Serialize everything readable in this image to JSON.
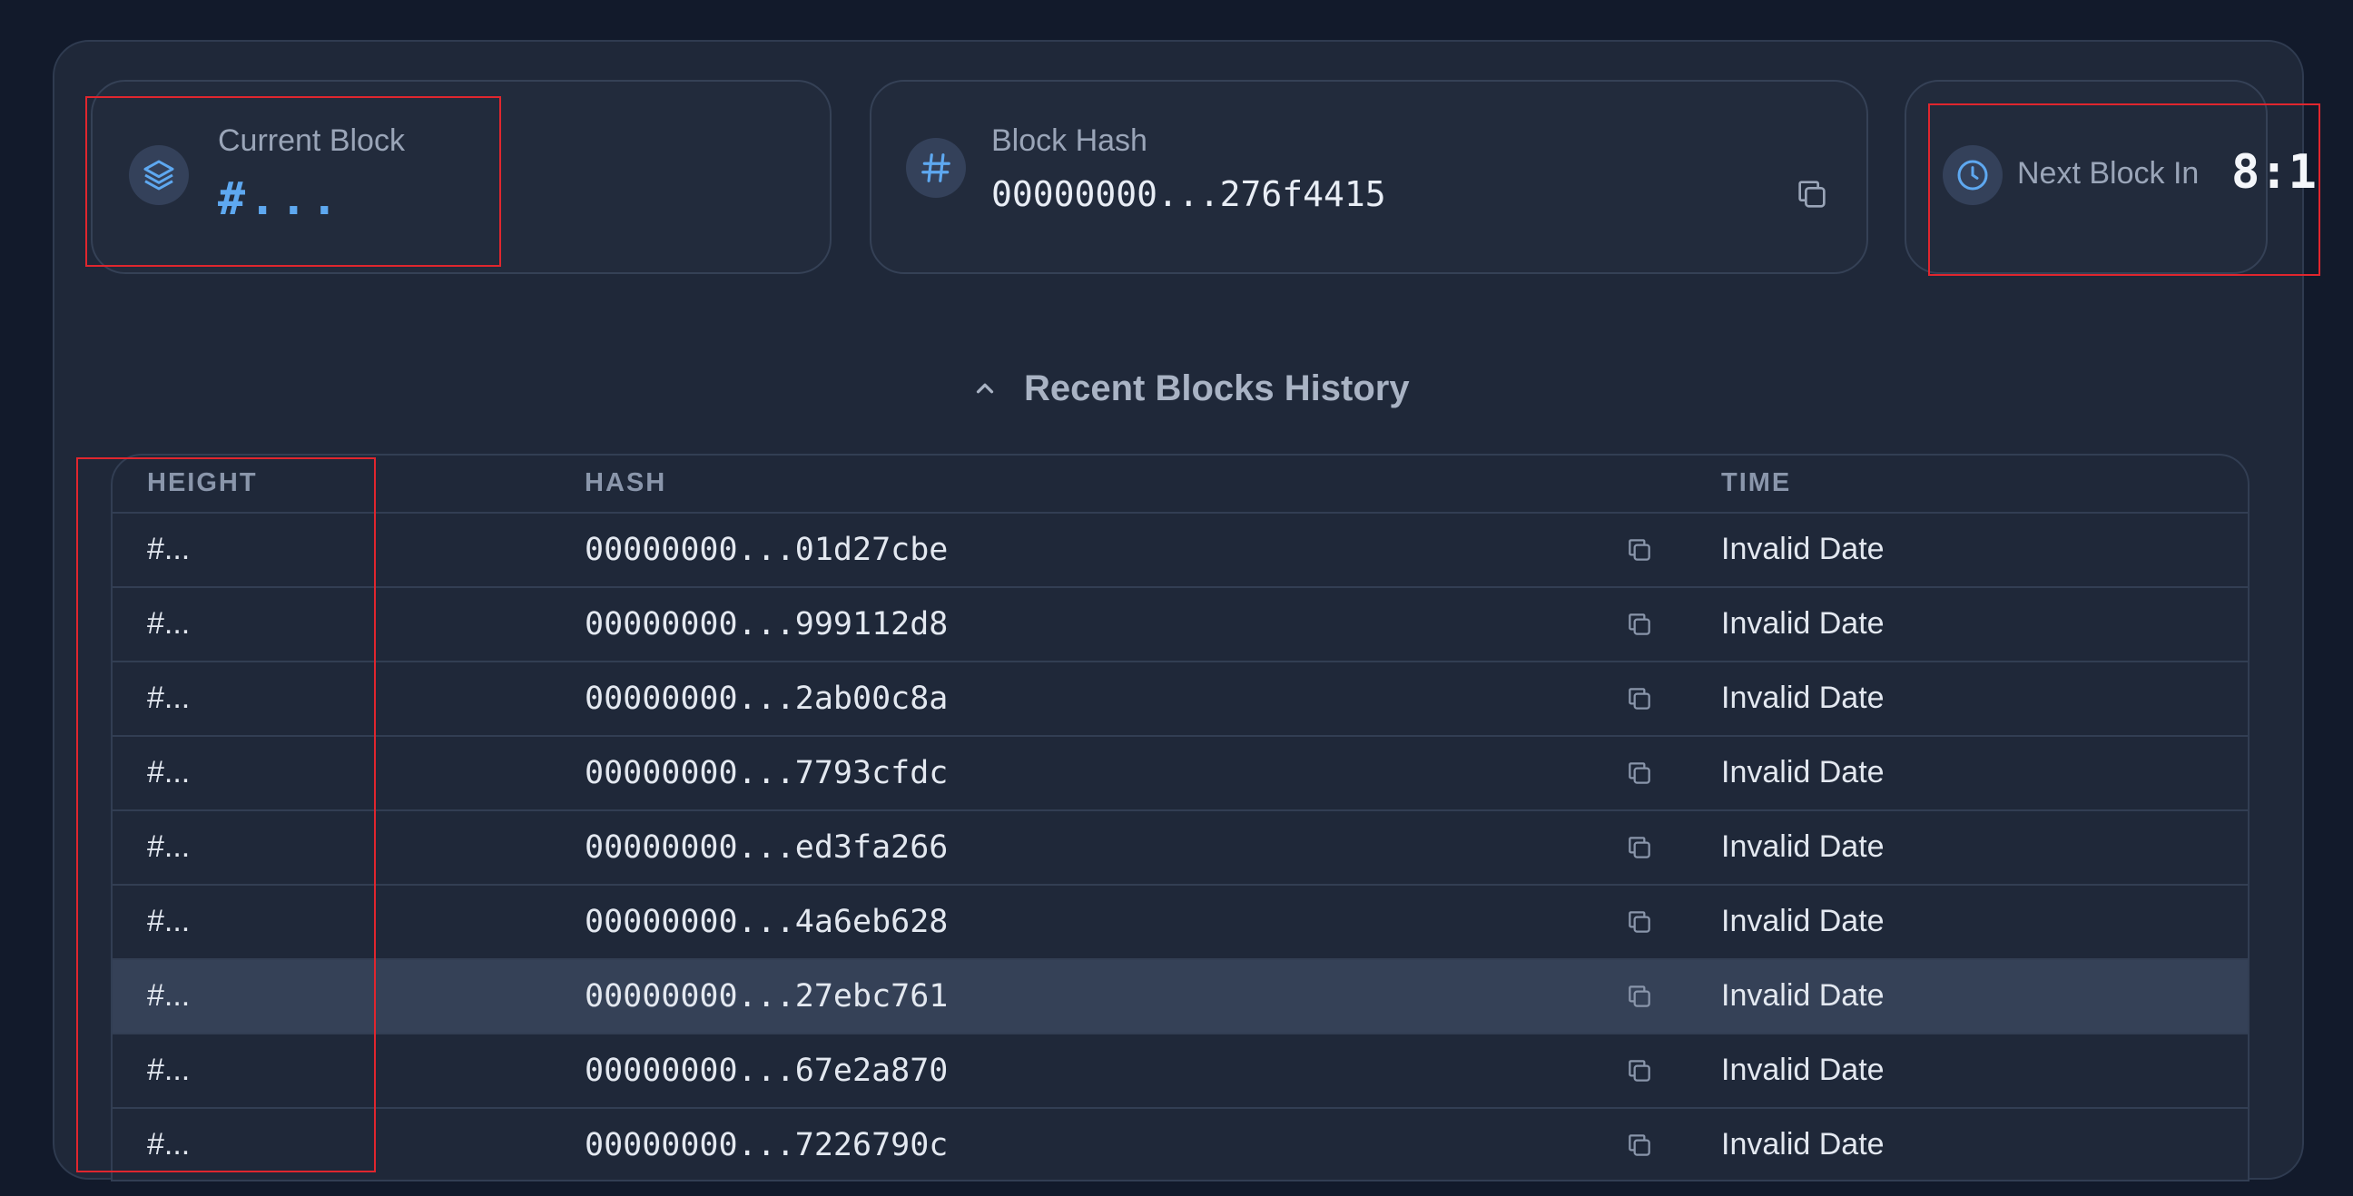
{
  "cards": {
    "current_block": {
      "label": "Current Block",
      "value": "#...",
      "icon": "layers-icon"
    },
    "block_hash": {
      "label": "Block Hash",
      "value": "00000000...276f4415",
      "icon": "hash-icon",
      "copy_icon": "copy-icon"
    },
    "next_block": {
      "label": "Next Block In",
      "value": "8:1",
      "icon": "clock-icon"
    }
  },
  "history": {
    "title": "Recent Blocks History",
    "toggle_icon": "chevron-up-icon",
    "columns": {
      "height": "HEIGHT",
      "hash": "HASH",
      "time": "TIME"
    },
    "rows": [
      {
        "height": "#...",
        "hash": "00000000...01d27cbe",
        "time": "Invalid Date"
      },
      {
        "height": "#...",
        "hash": "00000000...999112d8",
        "time": "Invalid Date"
      },
      {
        "height": "#...",
        "hash": "00000000...2ab00c8a",
        "time": "Invalid Date"
      },
      {
        "height": "#...",
        "hash": "00000000...7793cfdc",
        "time": "Invalid Date"
      },
      {
        "height": "#...",
        "hash": "00000000...ed3fa266",
        "time": "Invalid Date"
      },
      {
        "height": "#...",
        "hash": "00000000...4a6eb628",
        "time": "Invalid Date"
      },
      {
        "height": "#...",
        "hash": "00000000...27ebc761",
        "time": "Invalid Date"
      },
      {
        "height": "#...",
        "hash": "00000000...67e2a870",
        "time": "Invalid Date"
      },
      {
        "height": "#...",
        "hash": "00000000...7226790c",
        "time": "Invalid Date"
      }
    ]
  },
  "colors": {
    "background": "#121a2b",
    "panel": "#1f2839",
    "accent": "#5ea8f0",
    "highlight_row": "#354157",
    "annotation": "#e0262e"
  }
}
